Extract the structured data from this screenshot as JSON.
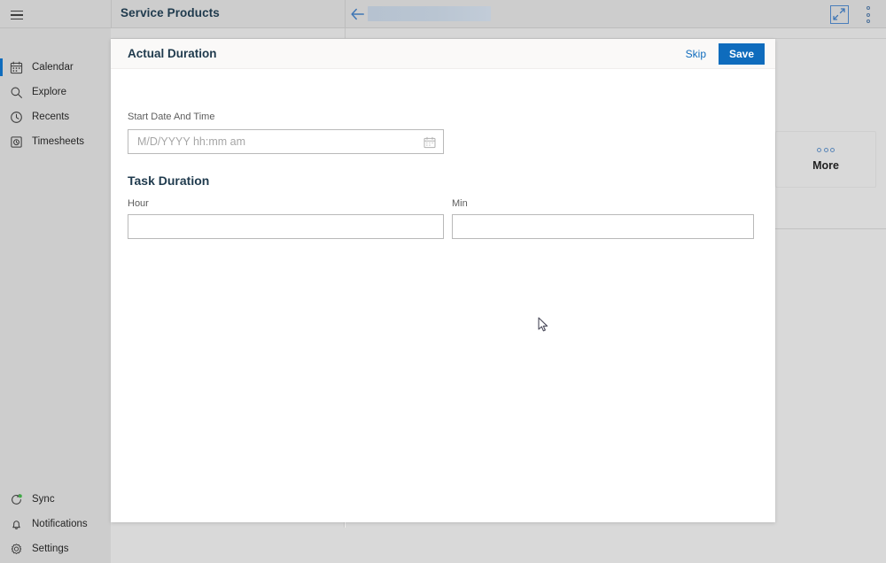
{
  "topbar": {
    "menu_icon": "hamburger-icon",
    "app_title": "Service Products",
    "back_icon": "back-arrow-icon",
    "redacted_field": "",
    "expand_icon": "expand-icon",
    "overflow_icon": "kebab-menu-icon"
  },
  "sidebar": {
    "items": [
      {
        "label": "Calendar",
        "icon": "calendar-icon",
        "active": true
      },
      {
        "label": "Explore",
        "icon": "search-icon",
        "active": false
      },
      {
        "label": "Recents",
        "icon": "clock-icon",
        "active": false
      },
      {
        "label": "Timesheets",
        "icon": "timesheet-icon",
        "active": false
      }
    ],
    "bottom_items": [
      {
        "label": "Sync",
        "icon": "sync-icon"
      },
      {
        "label": "Notifications",
        "icon": "bell-icon"
      },
      {
        "label": "Settings",
        "icon": "gear-icon"
      }
    ]
  },
  "background": {
    "more_card": {
      "label": "More",
      "icon": "ellipsis-icon"
    }
  },
  "dialog": {
    "title": "Actual Duration",
    "skip_label": "Skip",
    "save_label": "Save",
    "start_date": {
      "label": "Start Date And Time",
      "value": "",
      "placeholder": "M/D/YYYY  hh:mm am",
      "icon": "calendar-icon"
    },
    "section_title": "Task Duration",
    "hour": {
      "label": "Hour",
      "value": "",
      "placeholder": ""
    },
    "min": {
      "label": "Min",
      "value": "",
      "placeholder": ""
    }
  },
  "colors": {
    "accent": "#0f6cbd",
    "title_text": "#1f3a4d",
    "chrome": "#cdcdcd",
    "panel": "#d9d9d9",
    "dialog_header": "#faf9f8"
  }
}
